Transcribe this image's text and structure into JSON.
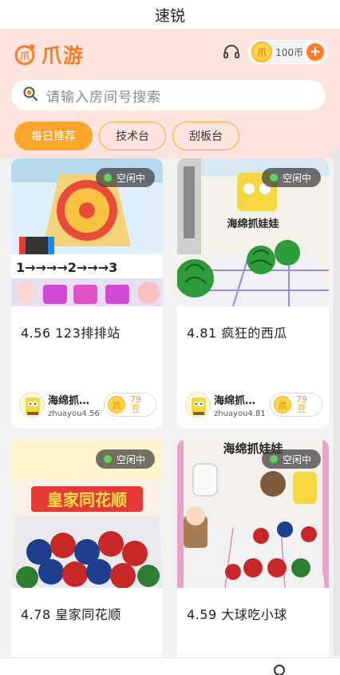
{
  "window": {
    "title": "速锐"
  },
  "app": {
    "logo_text": "爪游",
    "logo_mark_char": "爪",
    "accent": "#f47d2a"
  },
  "header": {
    "coins": {
      "coin_char": "爪",
      "value": "100币",
      "add_label": "+"
    }
  },
  "search": {
    "placeholder": "请输入房间号搜索"
  },
  "tabs": [
    {
      "label": "每日推荐",
      "active": true
    },
    {
      "label": "技术台",
      "active": false
    },
    {
      "label": "刮板台",
      "active": false
    }
  ],
  "rooms": [
    {
      "status": "空闲中",
      "title": "4.56 123排排站",
      "owner": "海绵抓…",
      "owner_id": "zhuayou4.56",
      "price_num": "79",
      "price_unit": "豆",
      "coin_char": "爪"
    },
    {
      "status": "空闲中",
      "title": "4.81 疯狂的西瓜",
      "owner": "海绵抓…",
      "owner_id": "zhuayou4.81",
      "price_num": "79",
      "price_unit": "豆",
      "coin_char": "爪"
    },
    {
      "status": "空闲中",
      "title": "4.78 皇家同花顺"
    },
    {
      "status": "空闲中",
      "title": "4.59 大球吃小球"
    }
  ],
  "thumb_text": {
    "r2": "海绵抓娃娃",
    "r3": "皇家同花顺",
    "r4": "海绵抓娃娃"
  }
}
